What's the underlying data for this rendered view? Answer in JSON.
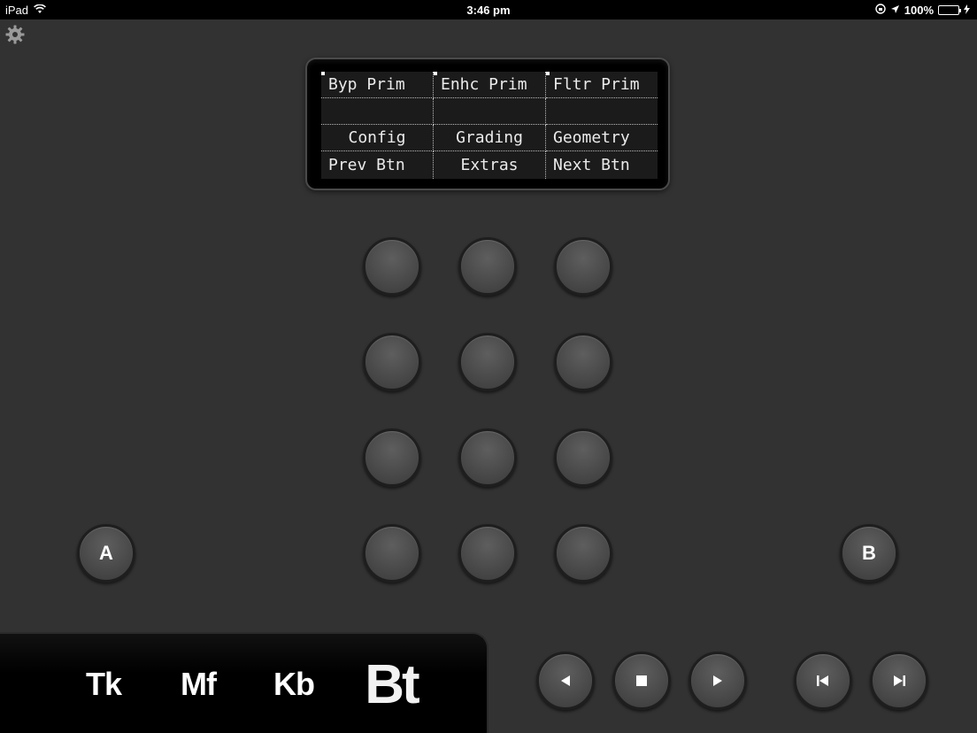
{
  "status_bar": {
    "device": "iPad",
    "time": "3:46 pm",
    "battery_text": "100%",
    "battery_level": 1.0,
    "icons": [
      "wifi-icon",
      "orientation-lock-icon",
      "location-arrow-icon",
      "battery-icon",
      "charging-bolt-icon"
    ]
  },
  "settings_icon": "gear-icon",
  "lcd": {
    "rows": [
      [
        "Byp Prim",
        "Enhc Prim",
        "Fltr Prim"
      ],
      [
        "",
        "",
        ""
      ],
      [
        "Config",
        "Grading",
        "Geometry"
      ],
      [
        "Prev Btn",
        "Extras",
        "Next Btn"
      ]
    ]
  },
  "side_buttons": {
    "a_label": "A",
    "b_label": "B"
  },
  "tabs": [
    {
      "label": "Tk",
      "selected": false
    },
    {
      "label": "Mf",
      "selected": false
    },
    {
      "label": "Kb",
      "selected": false
    },
    {
      "label": "Bt",
      "selected": true
    }
  ],
  "transport": [
    "rewind-icon",
    "stop-icon",
    "play-icon",
    "skip-previous-icon",
    "skip-next-icon"
  ],
  "colors": {
    "background": "#323232",
    "battery": "#4cd964"
  }
}
